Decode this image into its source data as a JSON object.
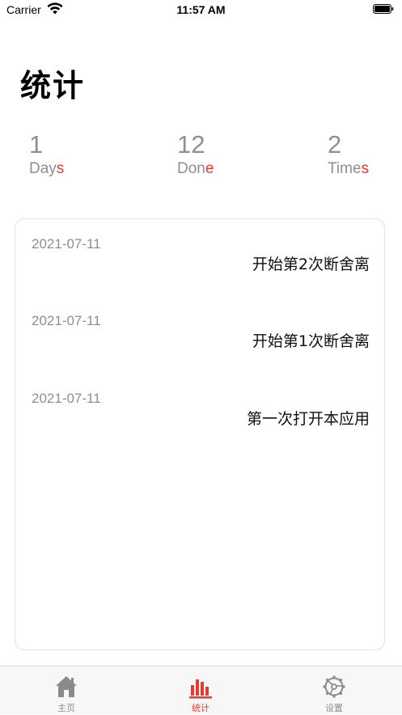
{
  "status_bar": {
    "carrier": "Carrier",
    "time": "11:57 AM"
  },
  "page": {
    "title": "统计"
  },
  "stats": [
    {
      "value": "1",
      "label_main": "Day",
      "label_accent": "s"
    },
    {
      "value": "12",
      "label_main": "Don",
      "label_accent": "e"
    },
    {
      "value": "2",
      "label_main": "Time",
      "label_accent": "s"
    }
  ],
  "log": [
    {
      "date": "2021-07-11",
      "text": "开始第2次断舍离"
    },
    {
      "date": "2021-07-11",
      "text": "开始第1次断舍离"
    },
    {
      "date": "2021-07-11",
      "text": "第一次打开本应用"
    }
  ],
  "tabs": [
    {
      "label": "主页",
      "icon": "home-icon",
      "active": false
    },
    {
      "label": "统计",
      "icon": "bar-chart-icon",
      "active": true
    },
    {
      "label": "设置",
      "icon": "settings-icon",
      "active": false
    }
  ],
  "colors": {
    "accent": "#e8392f",
    "muted": "#8e8e93",
    "inactive_icon": "#8a8a8a"
  }
}
